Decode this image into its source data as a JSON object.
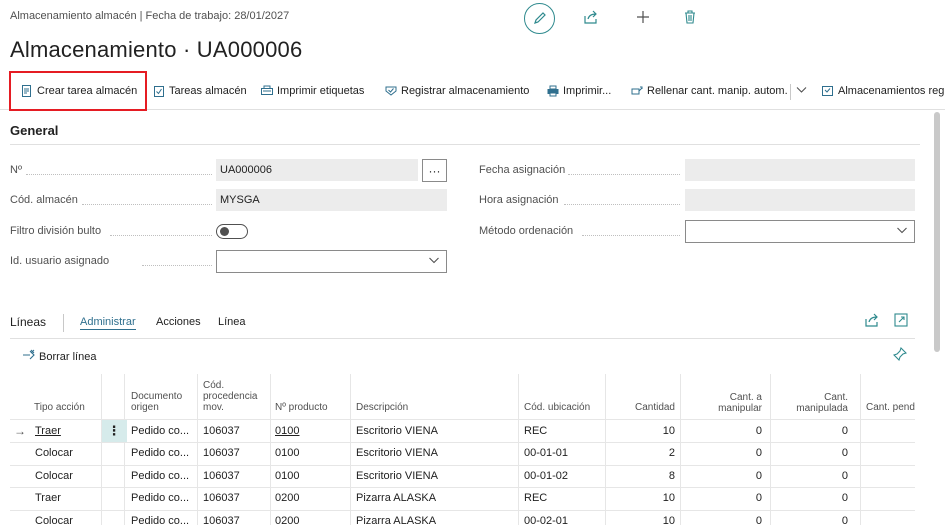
{
  "header": {
    "breadcrumb": "Almacenamiento almacén | Fecha de trabajo: 28/01/2027",
    "title": "Almacenamiento · UA000006",
    "actions": [
      "pencil-icon",
      "share-icon",
      "plus-icon",
      "trash-icon"
    ]
  },
  "toolbar": {
    "items": [
      {
        "label": "Crear tarea almacén",
        "icon": "create-task-icon"
      },
      {
        "label": "Tareas almacén",
        "icon": "checklist-icon"
      },
      {
        "label": "Imprimir etiquetas",
        "icon": "print-labels-icon"
      },
      {
        "label": "Registrar almacenamiento",
        "icon": "post-icon"
      },
      {
        "label": "Imprimir...",
        "icon": "printer-icon"
      },
      {
        "label": "Rellenar cant. manip. autom.",
        "icon": "autofill-icon"
      },
      {
        "label": "Almacenamientos reg",
        "icon": "registered-icon"
      }
    ]
  },
  "general": {
    "title": "General",
    "no_label": "Nº",
    "no_value": "UA000006",
    "cod_almacen_label": "Cód. almacén",
    "cod_almacen_value": "MYSGA",
    "filtro_label": "Filtro división bulto",
    "usuario_label": "Id. usuario asignado",
    "usuario_value": "",
    "fecha_asignacion_label": "Fecha asignación",
    "fecha_asignacion_value": "",
    "hora_asignacion_label": "Hora asignación",
    "hora_asignacion_value": "",
    "metodo_label": "Método ordenación",
    "metodo_value": "",
    "ellipsis": "···"
  },
  "lines": {
    "title": "Líneas",
    "tabs": [
      "Administrar",
      "Acciones",
      "Línea"
    ],
    "delete_label": "Borrar línea",
    "columns": {
      "tipo_accion": "Tipo acción",
      "documento_origen": "Documento origen",
      "cod_procedencia": "Cód. procedencia mov.",
      "n_producto": "Nº producto",
      "descripcion": "Descripción",
      "cod_ubicacion": "Cód. ubicación",
      "cantidad": "Cantidad",
      "cant_manipular": "Cant. a manipular",
      "cant_manipulada": "Cant. manipulada",
      "cant_pendiente": "Cant. pendi"
    },
    "rows": [
      {
        "tipo": "Traer",
        "doc": "Pedido co...",
        "proc": "106037",
        "prod": "0100",
        "desc": "Escritorio VIENA",
        "ubic": "REC",
        "cant": "10",
        "manip": "0",
        "manipulada": "0"
      },
      {
        "tipo": "Colocar",
        "doc": "Pedido co...",
        "proc": "106037",
        "prod": "0100",
        "desc": "Escritorio VIENA",
        "ubic": "00-01-01",
        "cant": "2",
        "manip": "0",
        "manipulada": "0"
      },
      {
        "tipo": "Colocar",
        "doc": "Pedido co...",
        "proc": "106037",
        "prod": "0100",
        "desc": "Escritorio VIENA",
        "ubic": "00-01-02",
        "cant": "8",
        "manip": "0",
        "manipulada": "0"
      },
      {
        "tipo": "Traer",
        "doc": "Pedido co...",
        "proc": "106037",
        "prod": "0200",
        "desc": "Pizarra ALASKA",
        "ubic": "REC",
        "cant": "10",
        "manip": "0",
        "manipulada": "0"
      },
      {
        "tipo": "Colocar",
        "doc": "Pedido co...",
        "proc": "106037",
        "prod": "0200",
        "desc": "Pizarra ALASKA",
        "ubic": "00-02-01",
        "cant": "10",
        "manip": "0",
        "manipulada": "0"
      }
    ]
  }
}
